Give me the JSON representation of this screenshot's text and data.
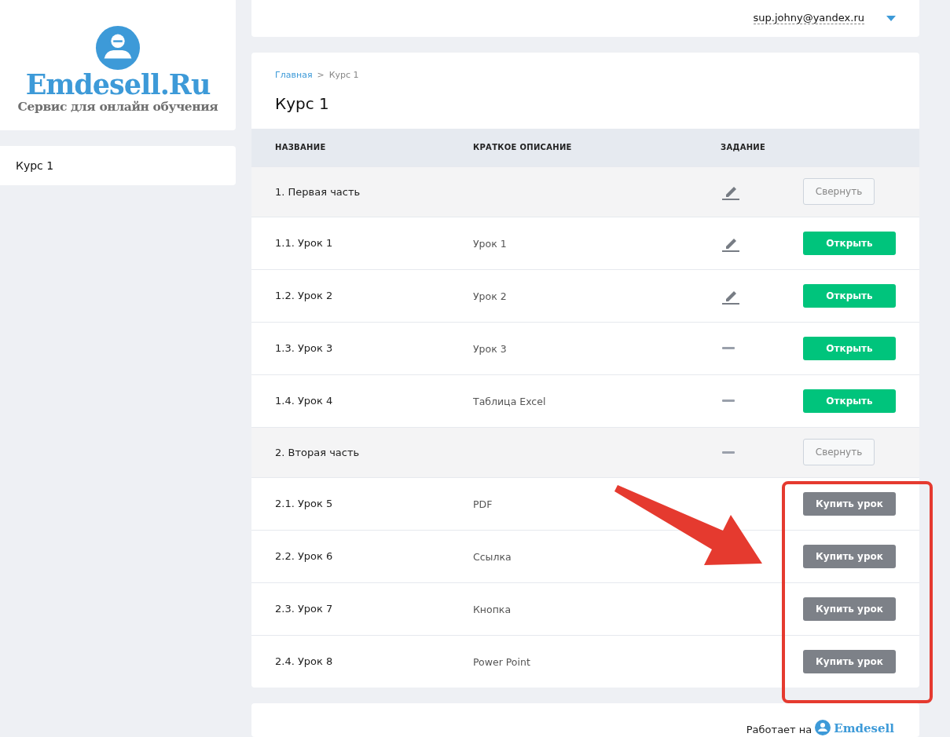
{
  "logo": {
    "name": "Emdesell.Ru",
    "tagline": "Сервис для онлайн обучения"
  },
  "sidebar": {
    "items": [
      {
        "label": "Курс 1",
        "selected": true
      }
    ]
  },
  "header": {
    "user_email": "sup.johny@yandex.ru"
  },
  "breadcrumbs": [
    {
      "label": "Главная",
      "link": true
    },
    {
      "label": ">",
      "link": false
    },
    {
      "label": "Курс 1",
      "link": false
    }
  ],
  "title": "Курс 1",
  "table": {
    "columns": [
      "НАЗВАНИЕ",
      "КРАТКОЕ ОПИСАНИЕ",
      "ЗАДАНИЕ"
    ],
    "rows": [
      {
        "kind": "section",
        "name": "1. Первая часть",
        "task": {
          "kind": "edit"
        },
        "action": {
          "kind": "collapse",
          "label": "Свернуть"
        }
      },
      {
        "kind": "lesson",
        "name": "1.1. Урок 1",
        "description": "Урок 1",
        "task": {
          "kind": "edit"
        },
        "action": {
          "kind": "open",
          "label": "Открыть"
        }
      },
      {
        "kind": "lesson",
        "name": "1.2. Урок 2",
        "description": "Урок 2",
        "task": {
          "kind": "edit"
        },
        "action": {
          "kind": "open",
          "label": "Открыть"
        }
      },
      {
        "kind": "lesson",
        "name": "1.3. Урок 3",
        "description": "Урок 3",
        "task": {
          "kind": "dash"
        },
        "action": {
          "kind": "open",
          "label": "Открыть"
        }
      },
      {
        "kind": "lesson",
        "name": "1.4. Урок 4",
        "description": "Таблица Excel",
        "task": {
          "kind": "dash"
        },
        "action": {
          "kind": "open",
          "label": "Открыть"
        }
      },
      {
        "kind": "section",
        "name": "2. Вторая часть",
        "task": {
          "kind": "dash"
        },
        "action": {
          "kind": "collapse",
          "label": "Свернуть"
        }
      },
      {
        "kind": "lesson",
        "name": "2.1. Урок 5",
        "description": "PDF",
        "action": {
          "kind": "buy",
          "label": "Купить урок"
        }
      },
      {
        "kind": "lesson",
        "name": "2.2. Урок 6",
        "description": "Ссылка",
        "action": {
          "kind": "buy",
          "label": "Купить урок"
        }
      },
      {
        "kind": "lesson",
        "name": "2.3. Урок 7",
        "description": "Кнопка",
        "action": {
          "kind": "buy",
          "label": "Купить урок"
        }
      },
      {
        "kind": "lesson",
        "name": "2.4. Урок 8",
        "description": "Power Point",
        "action": {
          "kind": "buy",
          "label": "Купить урок"
        }
      }
    ]
  },
  "footer": {
    "text": "Работает на",
    "brand": "Emdesell"
  },
  "annotation": {
    "kind": "arrow_frame"
  }
}
